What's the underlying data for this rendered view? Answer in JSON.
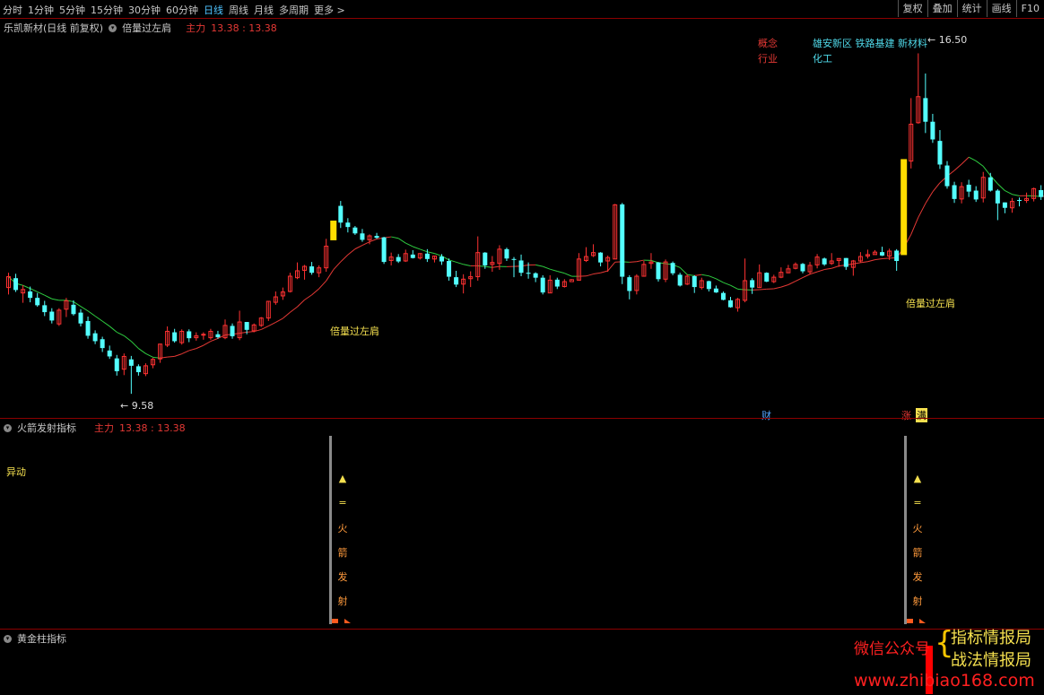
{
  "toolbar": {
    "tabs": [
      "分时",
      "1分钟",
      "5分钟",
      "15分钟",
      "30分钟",
      "60分钟",
      "日线",
      "周线",
      "月线",
      "多周期",
      "更多 >"
    ],
    "active_tab": "日线",
    "tools": [
      "复权",
      "叠加",
      "统计",
      "画线",
      "F10"
    ]
  },
  "main_panel": {
    "stock_title": "乐凯新材(日线 前复权)",
    "indicator_name": "倍量过左肩",
    "zhuli_label": "主力",
    "zhuli_value": "13.38 : 13.38",
    "concept_label": "概念",
    "concept_value": "雄安新区 铁路基建 新材料",
    "industry_label": "行业",
    "industry_value": "化工",
    "high_label": "16.50",
    "low_label": "9.58",
    "signal_label_1": "倍量过左肩",
    "signal_label_2": "倍量过左肩",
    "badge_cai": "财",
    "badge_zhang": "涨",
    "badge_mai": "满"
  },
  "rocket_panel": {
    "title": "火箭发射指标",
    "zhuli_label": "主力",
    "zhuli_value": "13.38 : 13.38",
    "yidong": "异动",
    "arrow": "▲",
    "eq": "=",
    "chars": [
      "火",
      "箭",
      "发",
      "射"
    ]
  },
  "gold_panel": {
    "title": "黄金柱指标"
  },
  "watermark": {
    "wechat": "微信公众号",
    "line1": "指标情报局",
    "line2": "战法情报局",
    "url": "www.zhibiao168.com"
  },
  "colors": {
    "up": "#ff3232",
    "down": "#54ffff",
    "ma_up": "#e53935",
    "ma_down": "#2ecc40",
    "signal": "#ffdd00"
  },
  "chart_data": {
    "type": "candlestick",
    "y_range": [
      9.2,
      16.8
    ],
    "candles": [
      [
        11.74,
        11.96,
        12.04,
        11.6
      ],
      [
        11.93,
        11.69,
        12.02,
        11.65
      ],
      [
        11.63,
        11.7,
        11.79,
        11.43
      ],
      [
        11.66,
        11.53,
        11.76,
        11.44
      ],
      [
        11.53,
        11.38,
        11.63,
        11.35
      ],
      [
        11.38,
        11.24,
        11.47,
        11.16
      ],
      [
        11.25,
        11.07,
        11.32,
        11.01
      ],
      [
        11.0,
        11.28,
        11.32,
        10.96
      ],
      [
        11.3,
        11.47,
        11.53,
        11.14
      ],
      [
        11.39,
        11.2,
        11.48,
        11.17
      ],
      [
        11.23,
        11.01,
        11.3,
        10.95
      ],
      [
        11.06,
        10.76,
        11.15,
        10.7
      ],
      [
        10.81,
        10.65,
        10.87,
        10.59
      ],
      [
        10.69,
        10.51,
        10.74,
        10.43
      ],
      [
        10.46,
        10.34,
        10.56,
        10.29
      ],
      [
        10.3,
        10.04,
        10.37,
        9.95
      ],
      [
        10.08,
        10.34,
        10.4,
        9.96
      ],
      [
        10.28,
        10.15,
        10.35,
        9.58
      ],
      [
        10.14,
        10.02,
        10.18,
        9.95
      ],
      [
        9.99,
        10.15,
        10.2,
        9.94
      ],
      [
        10.17,
        10.28,
        10.31,
        10.1
      ],
      [
        10.29,
        10.59,
        10.6,
        10.21
      ],
      [
        10.57,
        10.85,
        10.95,
        10.53
      ],
      [
        10.83,
        10.65,
        10.9,
        10.62
      ],
      [
        10.62,
        10.85,
        10.89,
        10.58
      ],
      [
        10.85,
        10.71,
        10.89,
        10.63
      ],
      [
        10.72,
        10.76,
        10.83,
        10.66
      ],
      [
        10.78,
        10.79,
        10.83,
        10.68
      ],
      [
        10.72,
        10.85,
        10.9,
        10.68
      ],
      [
        10.79,
        10.73,
        10.86,
        10.7
      ],
      [
        10.72,
        10.97,
        11.09,
        10.69
      ],
      [
        10.96,
        10.75,
        11.01,
        10.7
      ],
      [
        10.72,
        11.04,
        11.27,
        10.67
      ],
      [
        11.04,
        10.88,
        11.04,
        10.79
      ],
      [
        10.86,
        10.98,
        11.01,
        10.83
      ],
      [
        10.97,
        11.12,
        11.14,
        10.94
      ],
      [
        11.12,
        11.46,
        11.47,
        11.06
      ],
      [
        11.44,
        11.55,
        11.66,
        11.39
      ],
      [
        11.57,
        11.65,
        11.74,
        11.49
      ],
      [
        11.66,
        11.97,
        12.04,
        11.64
      ],
      [
        11.94,
        12.08,
        12.25,
        11.91
      ],
      [
        12.09,
        12.17,
        12.2,
        11.9
      ],
      [
        12.17,
        12.04,
        12.26,
        12.0
      ],
      [
        12.04,
        12.14,
        12.19,
        11.95
      ],
      [
        12.14,
        12.58,
        12.73,
        12.06
      ],
      [
        12.59,
        13.39,
        13.65,
        12.58
      ],
      [
        13.4,
        13.06,
        13.5,
        12.95
      ],
      [
        13.06,
        12.97,
        13.15,
        12.86
      ],
      [
        12.96,
        12.84,
        12.99,
        12.81
      ],
      [
        12.84,
        12.71,
        12.93,
        12.67
      ],
      [
        12.71,
        12.79,
        12.82,
        12.62
      ],
      [
        12.79,
        12.75,
        12.85,
        12.73
      ],
      [
        12.76,
        12.26,
        12.77,
        12.22
      ],
      [
        12.29,
        12.36,
        12.45,
        12.19
      ],
      [
        12.36,
        12.27,
        12.42,
        12.24
      ],
      [
        12.28,
        12.43,
        12.51,
        12.26
      ],
      [
        12.41,
        12.34,
        12.5,
        12.33
      ],
      [
        12.34,
        12.43,
        12.44,
        12.31
      ],
      [
        12.43,
        12.32,
        12.52,
        12.26
      ],
      [
        12.32,
        12.38,
        12.39,
        12.25
      ],
      [
        12.37,
        12.27,
        12.42,
        12.2
      ],
      [
        12.28,
        11.96,
        12.33,
        11.88
      ],
      [
        11.95,
        11.8,
        12.08,
        11.75
      ],
      [
        11.81,
        11.91,
        12.01,
        11.62
      ],
      [
        11.92,
        11.96,
        12.07,
        11.75
      ],
      [
        11.96,
        12.45,
        12.78,
        11.88
      ],
      [
        12.45,
        12.19,
        12.46,
        12.12
      ],
      [
        12.21,
        12.25,
        12.38,
        12.06
      ],
      [
        12.23,
        12.52,
        12.6,
        12.1
      ],
      [
        12.52,
        12.33,
        12.55,
        12.28
      ],
      [
        12.32,
        12.31,
        12.36,
        11.95
      ],
      [
        12.29,
        12.04,
        12.41,
        11.97
      ],
      [
        12.04,
        12.02,
        12.25,
        11.92
      ],
      [
        12.03,
        11.94,
        12.05,
        11.85
      ],
      [
        11.94,
        11.64,
        11.99,
        11.6
      ],
      [
        11.63,
        11.89,
        11.99,
        11.63
      ],
      [
        11.9,
        11.76,
        11.94,
        11.71
      ],
      [
        11.76,
        11.86,
        11.91,
        11.74
      ],
      [
        11.86,
        11.9,
        11.91,
        11.88
      ],
      [
        11.89,
        12.32,
        12.44,
        11.88
      ],
      [
        12.29,
        12.37,
        12.56,
        12.26
      ],
      [
        12.39,
        12.45,
        12.62,
        12.36
      ],
      [
        12.45,
        12.25,
        12.46,
        12.17
      ],
      [
        12.28,
        12.35,
        12.39,
        12.06
      ],
      [
        12.32,
        13.42,
        13.44,
        12.32
      ],
      [
        13.43,
        11.96,
        13.46,
        11.81
      ],
      [
        11.95,
        11.67,
        11.99,
        11.5
      ],
      [
        11.68,
        11.97,
        12.01,
        11.6
      ],
      [
        11.97,
        12.21,
        12.28,
        11.96
      ],
      [
        12.23,
        12.26,
        12.44,
        12.12
      ],
      [
        12.25,
        11.91,
        12.26,
        11.86
      ],
      [
        11.91,
        12.26,
        12.31,
        11.85
      ],
      [
        12.24,
        12.03,
        12.27,
        11.99
      ],
      [
        12.0,
        11.78,
        12.04,
        11.76
      ],
      [
        11.81,
        11.97,
        12.01,
        11.79
      ],
      [
        11.97,
        11.75,
        11.99,
        11.63
      ],
      [
        11.74,
        11.88,
        11.94,
        11.7
      ],
      [
        11.87,
        11.71,
        11.88,
        11.66
      ],
      [
        11.72,
        11.64,
        11.78,
        11.63
      ],
      [
        11.63,
        11.49,
        11.66,
        11.48
      ],
      [
        11.48,
        11.34,
        11.55,
        11.33
      ],
      [
        11.33,
        11.5,
        11.53,
        11.25
      ],
      [
        11.48,
        11.88,
        12.33,
        11.44
      ],
      [
        11.89,
        11.74,
        11.93,
        11.61
      ],
      [
        11.74,
        12.04,
        12.21,
        11.73
      ],
      [
        12.04,
        11.86,
        12.05,
        11.85
      ],
      [
        11.86,
        11.95,
        12.0,
        11.83
      ],
      [
        11.95,
        12.05,
        12.15,
        11.93
      ],
      [
        12.04,
        12.12,
        12.2,
        12.03
      ],
      [
        12.13,
        12.21,
        12.25,
        12.11
      ],
      [
        12.22,
        12.07,
        12.24,
        12.03
      ],
      [
        12.06,
        12.19,
        12.26,
        12.01
      ],
      [
        12.2,
        12.36,
        12.42,
        12.13
      ],
      [
        12.33,
        12.21,
        12.35,
        12.18
      ],
      [
        12.23,
        12.28,
        12.44,
        12.2
      ],
      [
        12.29,
        12.33,
        12.33,
        12.16
      ],
      [
        12.34,
        12.16,
        12.34,
        12.1
      ],
      [
        12.15,
        12.28,
        12.3,
        11.98
      ],
      [
        12.28,
        12.37,
        12.46,
        12.25
      ],
      [
        12.38,
        12.41,
        12.51,
        12.33
      ],
      [
        12.41,
        12.46,
        12.5,
        12.41
      ],
      [
        12.46,
        12.39,
        12.57,
        12.38
      ],
      [
        12.38,
        12.48,
        12.53,
        12.3
      ],
      [
        12.49,
        12.28,
        12.52,
        12.08
      ],
      [
        12.28,
        14.3,
        14.33,
        12.25
      ],
      [
        14.31,
        15.06,
        15.59,
        14.16
      ],
      [
        15.09,
        15.62,
        16.5,
        15.07
      ],
      [
        15.59,
        15.11,
        16.09,
        14.88
      ],
      [
        15.11,
        14.75,
        15.27,
        14.68
      ],
      [
        14.72,
        14.24,
        14.94,
        14.15
      ],
      [
        14.22,
        13.8,
        14.31,
        13.75
      ],
      [
        13.82,
        13.54,
        13.89,
        13.46
      ],
      [
        13.54,
        13.79,
        13.88,
        13.45
      ],
      [
        13.83,
        13.69,
        13.93,
        13.58
      ],
      [
        13.71,
        13.53,
        13.8,
        13.48
      ],
      [
        13.56,
        13.98,
        14.09,
        13.47
      ],
      [
        13.98,
        13.71,
        14.07,
        13.69
      ],
      [
        13.71,
        13.45,
        13.74,
        13.11
      ],
      [
        13.47,
        13.36,
        13.47,
        13.25
      ],
      [
        13.36,
        13.49,
        13.56,
        13.26
      ],
      [
        13.52,
        13.5,
        13.57,
        13.39
      ],
      [
        13.51,
        13.55,
        13.67,
        13.46
      ],
      [
        13.55,
        13.75,
        13.77,
        13.49
      ],
      [
        13.72,
        13.58,
        13.82,
        13.52
      ],
      [
        13.59,
        13.66,
        13.75,
        13.56
      ]
    ],
    "signal_bars": [
      {
        "index": 45,
        "open": 12.7,
        "close": 13.1
      },
      {
        "index": 124,
        "open": 12.4,
        "close": 14.35
      }
    ]
  }
}
